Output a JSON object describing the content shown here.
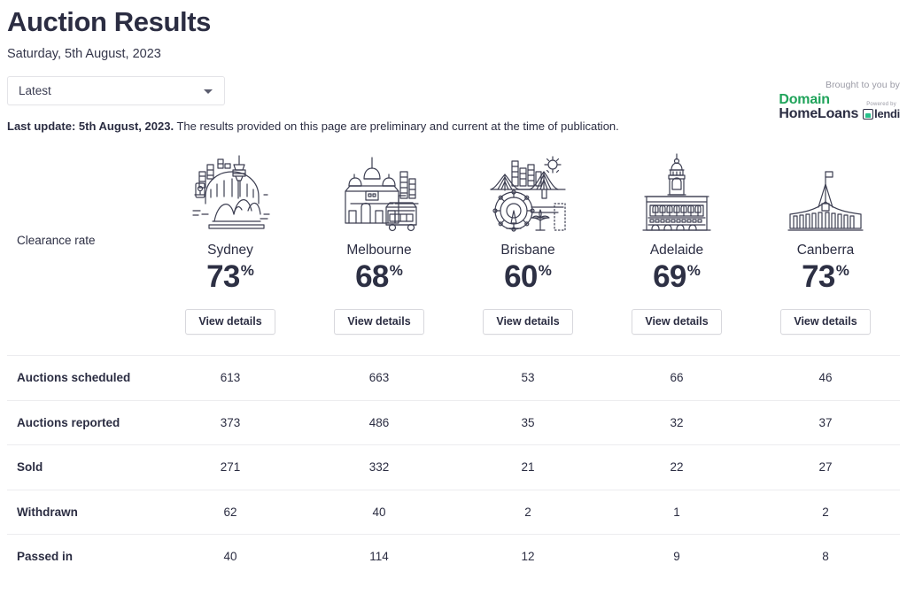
{
  "header": {
    "title": "Auction Results",
    "subtitle": "Saturday, 5th August, 2023",
    "filter": {
      "selected": "Latest",
      "options": [
        "Latest"
      ],
      "chevron_icon": "chevron-down-icon"
    },
    "last_update_bold": "Last update: 5th August, 2023.",
    "last_update_rest": " The results provided on this page are preliminary and current at the time of publication."
  },
  "branding": {
    "brought_to_you_by": "Brought to you by",
    "domain_line1": "Domain",
    "domain_line2": "HomeLoans",
    "powered_by": "Powered by",
    "partner": "lendi",
    "domain_green": "#1fa35a",
    "lendi_green": "#27c08a",
    "text_dark": "#2b2d42"
  },
  "clearance": {
    "row_label": "Clearance rate",
    "button_label": "View details"
  },
  "cities": [
    {
      "name": "Sydney",
      "icon": "sydney-skyline-icon",
      "rate": "73",
      "pct": "%"
    },
    {
      "name": "Melbourne",
      "icon": "melbourne-skyline-icon",
      "rate": "68",
      "pct": "%"
    },
    {
      "name": "Brisbane",
      "icon": "brisbane-skyline-icon",
      "rate": "60",
      "pct": "%"
    },
    {
      "name": "Adelaide",
      "icon": "adelaide-townhall-icon",
      "rate": "69",
      "pct": "%"
    },
    {
      "name": "Canberra",
      "icon": "canberra-parliament-icon",
      "rate": "73",
      "pct": "%"
    }
  ],
  "chart_data": {
    "type": "table",
    "title": "Auction Results",
    "subtitle": "Saturday, 5th August, 2023",
    "categories": [
      "Sydney",
      "Melbourne",
      "Brisbane",
      "Adelaide",
      "Canberra"
    ],
    "clearance_rate_percent": [
      73,
      68,
      60,
      69,
      73
    ],
    "row_labels": [
      "Auctions scheduled",
      "Auctions reported",
      "Sold",
      "Withdrawn",
      "Passed in"
    ],
    "series": [
      {
        "name": "Auctions scheduled",
        "values": [
          613,
          663,
          53,
          66,
          46
        ]
      },
      {
        "name": "Auctions reported",
        "values": [
          373,
          486,
          35,
          32,
          37
        ]
      },
      {
        "name": "Sold",
        "values": [
          271,
          332,
          21,
          22,
          27
        ]
      },
      {
        "name": "Withdrawn",
        "values": [
          62,
          40,
          2,
          1,
          2
        ]
      },
      {
        "name": "Passed in",
        "values": [
          40,
          114,
          12,
          9,
          8
        ]
      }
    ]
  },
  "table": {
    "rows": [
      {
        "label": "Auctions scheduled",
        "values": [
          "613",
          "663",
          "53",
          "66",
          "46"
        ]
      },
      {
        "label": "Auctions reported",
        "values": [
          "373",
          "486",
          "35",
          "32",
          "37"
        ]
      },
      {
        "label": "Sold",
        "values": [
          "271",
          "332",
          "21",
          "22",
          "27"
        ]
      },
      {
        "label": "Withdrawn",
        "values": [
          "62",
          "40",
          "2",
          "1",
          "2"
        ]
      },
      {
        "label": "Passed in",
        "values": [
          "40",
          "114",
          "12",
          "9",
          "8"
        ]
      }
    ]
  }
}
